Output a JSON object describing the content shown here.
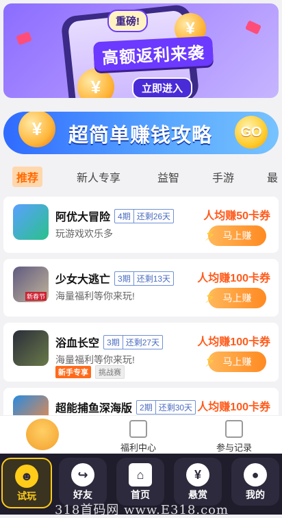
{
  "hero_banner": {
    "tag": "重磅!",
    "headline": "高额返利来袭",
    "cta": "立即进入",
    "coin_symbol": "¥"
  },
  "strategy_banner": {
    "coin_symbol": "¥",
    "title": "超简单赚钱攻略",
    "go": "GO"
  },
  "tabs": [
    {
      "label": "推荐",
      "active": true
    },
    {
      "label": "新人专享"
    },
    {
      "label": "益智"
    },
    {
      "label": "手游"
    },
    {
      "label": "最"
    }
  ],
  "games": [
    {
      "name": "阿优大冒险",
      "period": "4期",
      "remaining": "还剩26天",
      "desc": "玩游戏欢乐多",
      "reward": "人均赚50卡券",
      "button": "马上赚"
    },
    {
      "name": "少女大逃亡",
      "period": "3期",
      "remaining": "还剩13天",
      "desc": "海量福利等你来玩!",
      "reward": "人均赚100卡券",
      "button": "马上赚",
      "icon_text": "新春节"
    },
    {
      "name": "浴血长空",
      "period": "3期",
      "remaining": "还剩27天",
      "desc": "海量福利等你来玩!",
      "reward": "人均赚100卡券",
      "button": "马上赚",
      "tags": [
        "新手专享",
        "挑战赛"
      ]
    },
    {
      "name": "超能捕鱼深海版",
      "period": "2期",
      "remaining": "还剩30天",
      "reward": "人均赚100卡券"
    }
  ],
  "sub_nav": {
    "welfare": "福利中心",
    "records": "参与记录"
  },
  "bottom_nav": [
    {
      "label": "试玩",
      "icon": "face-icon",
      "active": true
    },
    {
      "label": "好友",
      "icon": "share-icon"
    },
    {
      "label": "首页",
      "icon": "home-icon"
    },
    {
      "label": "悬赏",
      "icon": "yen-icon",
      "glyph": "¥"
    },
    {
      "label": "我的",
      "icon": "profile-icon"
    }
  ],
  "watermark": "318首码网 www.E318.com",
  "colors": {
    "accent": "#ff6a00",
    "reward": "#ff5a1a",
    "nav_bg": "#1f1c2c",
    "nav_active": "#ffcc1a"
  }
}
